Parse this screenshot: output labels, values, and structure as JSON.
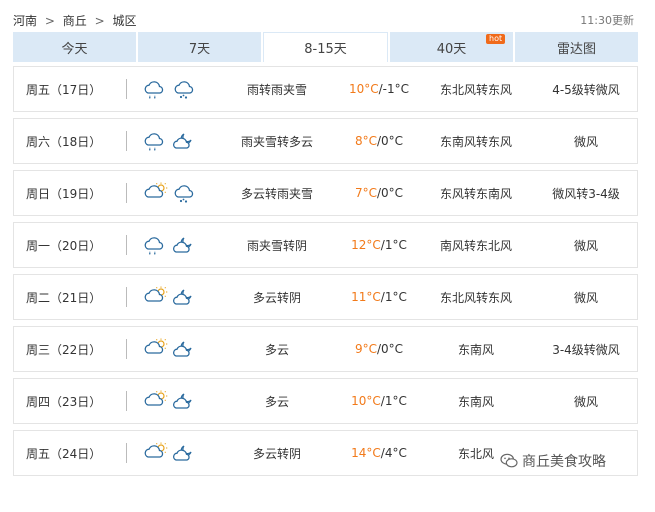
{
  "breadcrumb": {
    "province": "河南",
    "city": "商丘",
    "district": "城区",
    "separator": ">"
  },
  "updated": "11:30更新",
  "tabs": [
    {
      "label": "今天"
    },
    {
      "label": "7天"
    },
    {
      "label": "8-15天",
      "active": true
    },
    {
      "label": "40天",
      "badge": "hot"
    },
    {
      "label": "雷达图"
    }
  ],
  "forecast": [
    {
      "day": "周五（17日）",
      "icons": [
        "rain-sleet-icon",
        "snow-rain-icon"
      ],
      "desc": "雨转雨夹雪",
      "hi": "10°C",
      "lo": "/-1°C",
      "wind": "东北风转东风",
      "level": "4-5级转微风"
    },
    {
      "day": "周六（18日）",
      "icons": [
        "sleet-icon",
        "partly-cloudy-icon"
      ],
      "desc": "雨夹雪转多云",
      "hi": "8°C",
      "lo": "/0°C",
      "wind": "东南风转东风",
      "level": "微风"
    },
    {
      "day": "周日（19日）",
      "icons": [
        "partly-cloudy-sun-icon",
        "snow-rain-icon"
      ],
      "desc": "多云转雨夹雪",
      "hi": "7°C",
      "lo": "/0°C",
      "wind": "东风转东南风",
      "level": "微风转3-4级"
    },
    {
      "day": "周一（20日）",
      "icons": [
        "sleet-icon",
        "overcast-icon"
      ],
      "desc": "雨夹雪转阴",
      "hi": "12°C",
      "lo": "/1°C",
      "wind": "南风转东北风",
      "level": "微风"
    },
    {
      "day": "周二（21日）",
      "icons": [
        "partly-cloudy-sun-icon",
        "overcast-icon"
      ],
      "desc": "多云转阴",
      "hi": "11°C",
      "lo": "/1°C",
      "wind": "东北风转东风",
      "level": "微风"
    },
    {
      "day": "周三（22日）",
      "icons": [
        "partly-cloudy-sun-icon",
        "partly-cloudy-icon"
      ],
      "desc": "多云",
      "hi": "9°C",
      "lo": "/0°C",
      "wind": "东南风",
      "level": "3-4级转微风"
    },
    {
      "day": "周四（23日）",
      "icons": [
        "partly-cloudy-sun-icon",
        "partly-cloudy-icon"
      ],
      "desc": "多云",
      "hi": "10°C",
      "lo": "/1°C",
      "wind": "东南风",
      "level": "微风"
    },
    {
      "day": "周五（24日）",
      "icons": [
        "partly-cloudy-sun-icon",
        "overcast-icon"
      ],
      "desc": "多云转阴",
      "hi": "14°C",
      "lo": "/4°C",
      "wind": "东北风",
      "level": ""
    }
  ],
  "watermark": {
    "text": "商丘美食攻略",
    "icon": "wechat-icon"
  },
  "colors": {
    "accent_tab": "#dbe9f6",
    "hi_temp": "#f27a1a",
    "hot_badge": "#f06a1a"
  }
}
